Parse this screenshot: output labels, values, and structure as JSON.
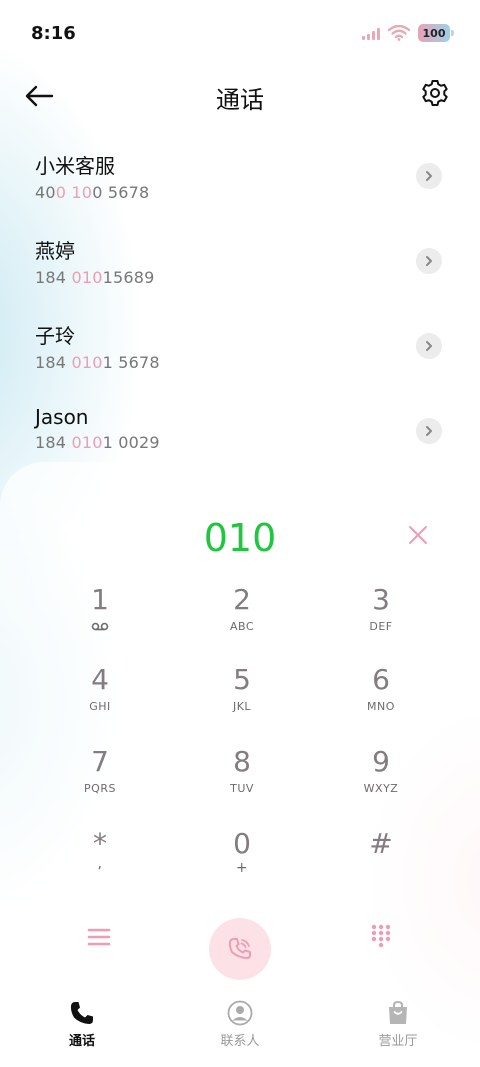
{
  "status_bar": {
    "time": "8:16",
    "battery": "100"
  },
  "header": {
    "title": "通话"
  },
  "contacts": [
    {
      "name": "小米客服",
      "number_parts": [
        "40",
        "0 10",
        "0 5678"
      ]
    },
    {
      "name": "燕婷",
      "number_parts": [
        "184 ",
        "010",
        "15689"
      ]
    },
    {
      "name": "子玲",
      "number_parts": [
        "184 ",
        "010",
        "1 5678"
      ]
    },
    {
      "name": "Jason",
      "number_parts": [
        "184 ",
        "010",
        "1 0029"
      ]
    }
  ],
  "dialer": {
    "input": "010",
    "keys": [
      {
        "digit": "1",
        "letters": ""
      },
      {
        "digit": "2",
        "letters": "ABC"
      },
      {
        "digit": "3",
        "letters": "DEF"
      },
      {
        "digit": "4",
        "letters": "GHI"
      },
      {
        "digit": "5",
        "letters": "JKL"
      },
      {
        "digit": "6",
        "letters": "MNO"
      },
      {
        "digit": "7",
        "letters": "PQRS"
      },
      {
        "digit": "8",
        "letters": "TUV"
      },
      {
        "digit": "9",
        "letters": "WXYZ"
      },
      {
        "digit": "*",
        "letters": ","
      },
      {
        "digit": "0",
        "letters": "+"
      },
      {
        "digit": "#",
        "letters": ""
      }
    ]
  },
  "tabs": [
    {
      "label": "通话",
      "icon": "phone-icon",
      "active": true
    },
    {
      "label": "联系人",
      "icon": "contacts-icon",
      "active": false
    },
    {
      "label": "营业厅",
      "icon": "shopping-bag-icon",
      "active": false
    }
  ],
  "colors": {
    "accent_pink": "#ef9db1",
    "dial_green": "#1fc63e",
    "call_bg": "#fce2e7"
  }
}
